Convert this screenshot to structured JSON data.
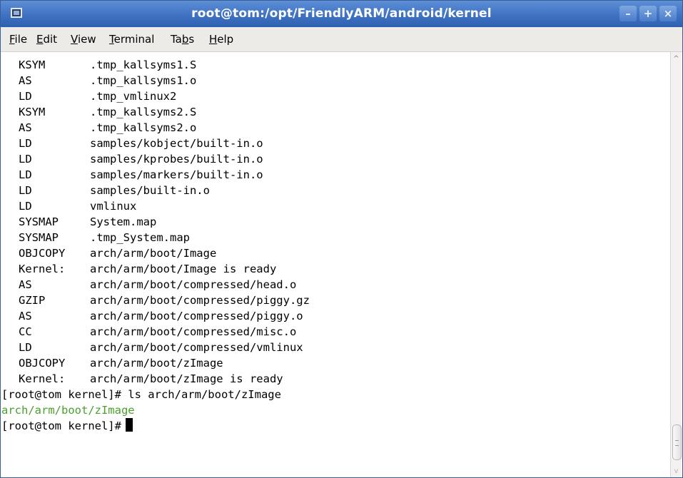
{
  "window": {
    "title": "root@tom:/opt/FriendlyARM/android/kernel",
    "buttons": {
      "minimize": "–",
      "maximize": "+",
      "close": "×"
    }
  },
  "menu": [
    {
      "mnemonic": "F",
      "rest": "ile"
    },
    {
      "mnemonic": "E",
      "rest": "dit"
    },
    {
      "mnemonic": "V",
      "rest": "iew"
    },
    {
      "mnemonic": "T",
      "rest": "erminal"
    },
    {
      "pre": "Ta",
      "mnemonic": "b",
      "rest": "s"
    },
    {
      "mnemonic": "H",
      "rest": "elp"
    }
  ],
  "terminal": {
    "build_lines": [
      {
        "tag": "KSYM",
        "arg": ".tmp_kallsyms1.S"
      },
      {
        "tag": "AS",
        "arg": ".tmp_kallsyms1.o"
      },
      {
        "tag": "LD",
        "arg": ".tmp_vmlinux2"
      },
      {
        "tag": "KSYM",
        "arg": ".tmp_kallsyms2.S"
      },
      {
        "tag": "AS",
        "arg": ".tmp_kallsyms2.o"
      },
      {
        "tag": "LD",
        "arg": "samples/kobject/built-in.o"
      },
      {
        "tag": "LD",
        "arg": "samples/kprobes/built-in.o"
      },
      {
        "tag": "LD",
        "arg": "samples/markers/built-in.o"
      },
      {
        "tag": "LD",
        "arg": "samples/built-in.o"
      },
      {
        "tag": "LD",
        "arg": "vmlinux"
      },
      {
        "tag": "SYSMAP",
        "arg": "System.map"
      },
      {
        "tag": "SYSMAP",
        "arg": ".tmp_System.map"
      },
      {
        "tag": "OBJCOPY",
        "arg": "arch/arm/boot/Image"
      },
      {
        "tag": "Kernel:",
        "arg": "arch/arm/boot/Image is ready"
      },
      {
        "tag": "AS",
        "arg": "arch/arm/boot/compressed/head.o"
      },
      {
        "tag": "GZIP",
        "arg": "arch/arm/boot/compressed/piggy.gz"
      },
      {
        "tag": "AS",
        "arg": "arch/arm/boot/compressed/piggy.o"
      },
      {
        "tag": "CC",
        "arg": "arch/arm/boot/compressed/misc.o"
      },
      {
        "tag": "LD",
        "arg": "arch/arm/boot/compressed/vmlinux"
      },
      {
        "tag": "OBJCOPY",
        "arg": "arch/arm/boot/zImage"
      },
      {
        "tag": "Kernel:",
        "arg": "arch/arm/boot/zImage is ready"
      }
    ],
    "command_line": "[root@tom kernel]# ls arch/arm/boot/zImage",
    "output_line": "arch/arm/boot/zImage",
    "prompt": "[root@tom kernel]#",
    "output_color": "#4aa02c"
  },
  "icons": [
    "terminal-app-icon",
    "minimize-icon",
    "maximize-icon",
    "close-icon",
    "scroll-up-arrow-icon",
    "scroll-down-arrow-icon"
  ]
}
